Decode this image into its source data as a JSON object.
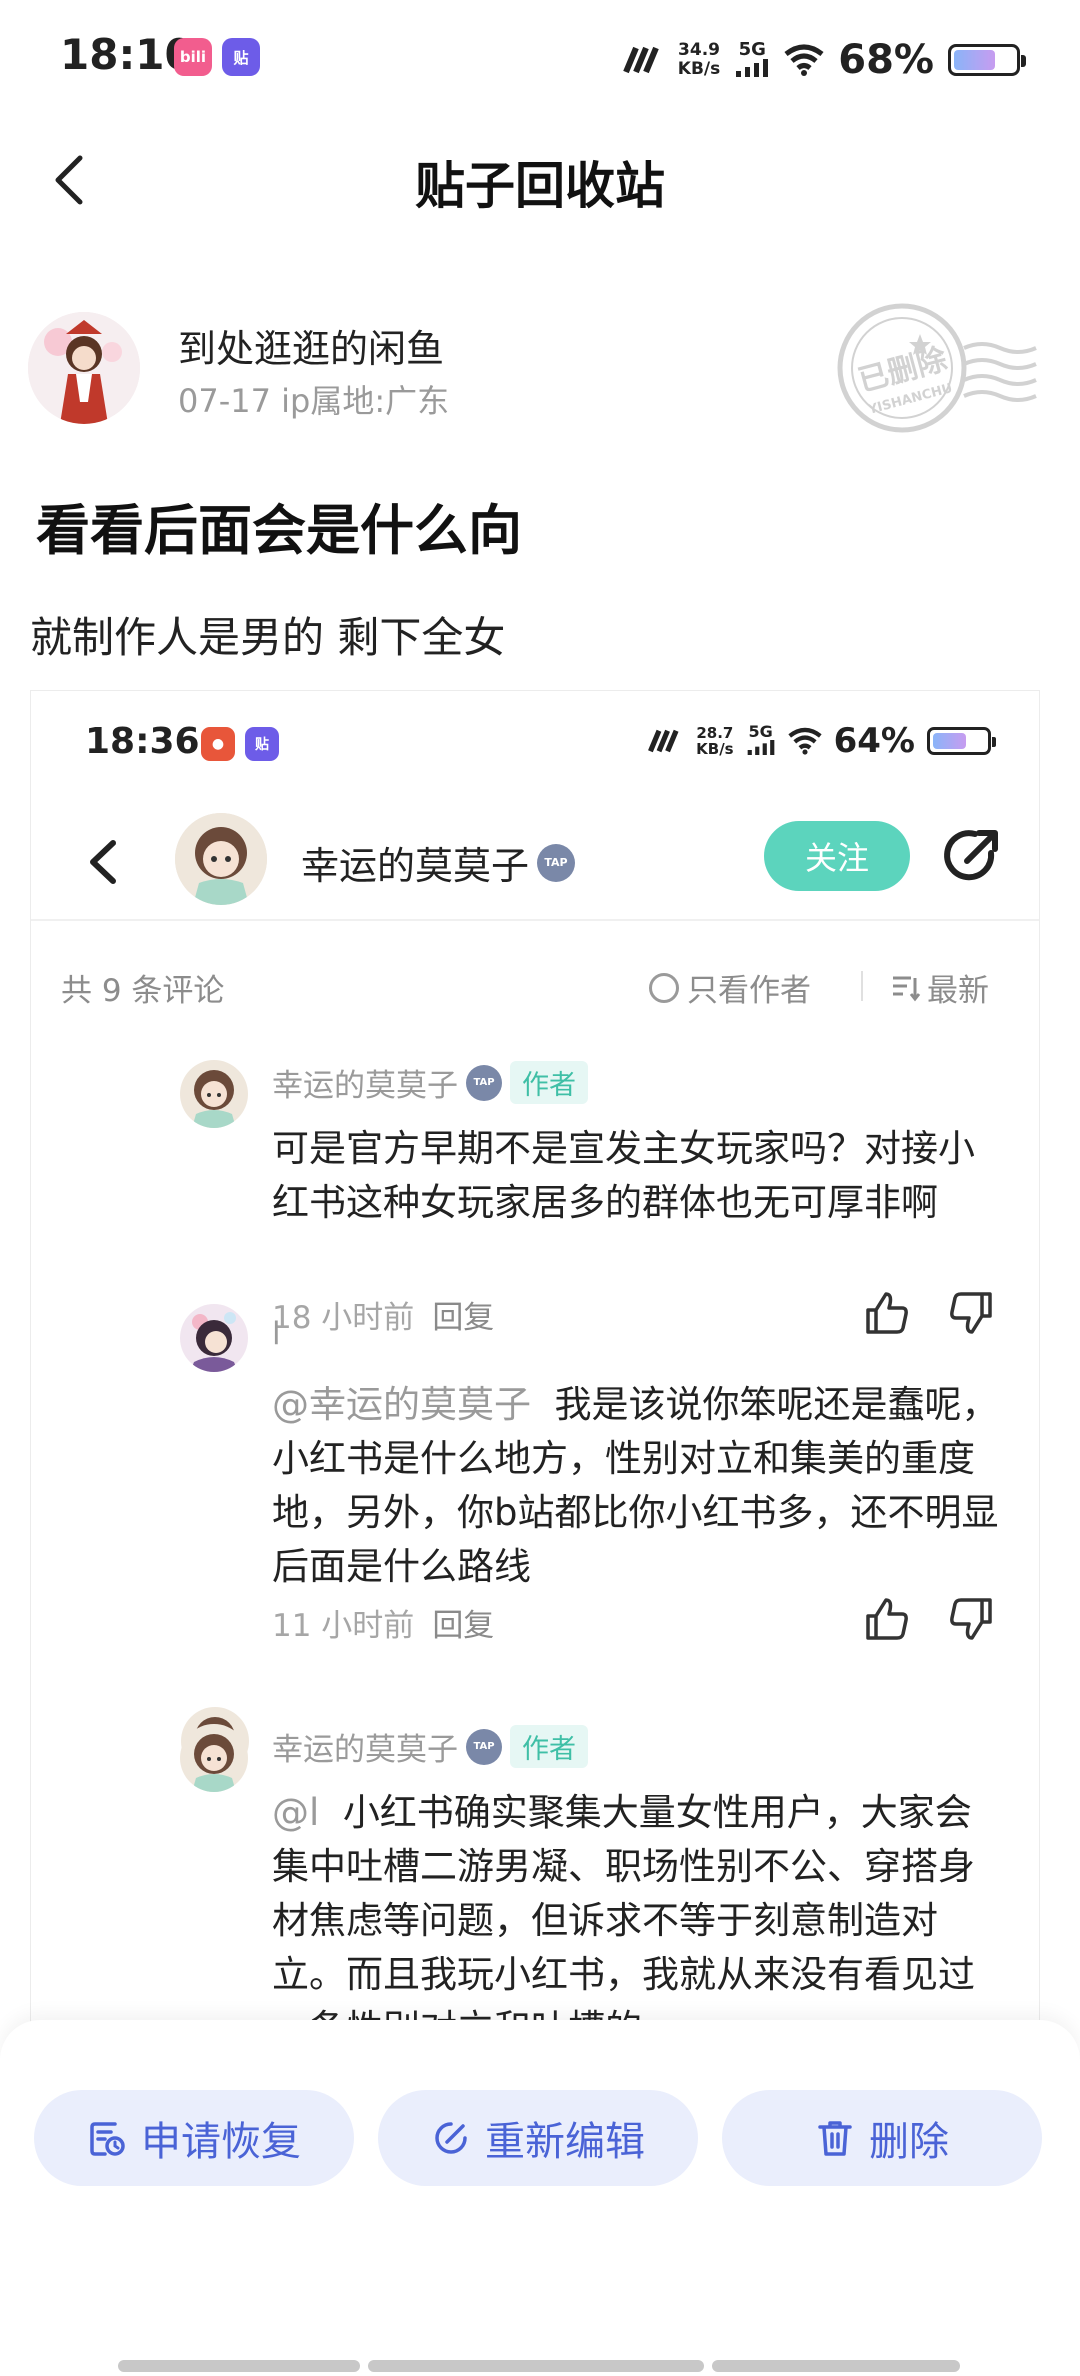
{
  "status_bar": {
    "time": "18:10",
    "app_icons": [
      "bilibili-icon",
      "tieba-icon"
    ],
    "speed_value": "34.9",
    "speed_unit": "KB/s",
    "network": "5G",
    "battery": "68%",
    "battery_level": 0.68
  },
  "header": {
    "back_icon": "chevron-left-icon",
    "title": "贴子回收站"
  },
  "author": {
    "name": "到处逛逛的闲鱼",
    "meta": "07-17  ip属地:广东",
    "stamp_text": "已删除",
    "stamp_subtext": "YISHANCHU"
  },
  "post": {
    "title": "看看后面会是什么向",
    "body": "就制作人是男的 剩下全女"
  },
  "screenshot": {
    "status_bar": {
      "time": "18:36",
      "speed_value": "28.7",
      "speed_unit": "KB/s",
      "network": "5G",
      "battery": "64%",
      "battery_level": 0.64
    },
    "header": {
      "username": "幸运的莫莫子",
      "badge": "TAP",
      "follow_label": "关注"
    },
    "filter": {
      "count_label": "共 9 条评论",
      "only_author_label": "只看作者",
      "sort_label": "最新"
    },
    "comments": [
      {
        "name": "幸运的莫莫子",
        "badge": "TAP",
        "tag": "作者",
        "mention": "",
        "text": "可是官方早期不是宣发主女玩家吗？对接小红书这种女玩家居多的群体也无可厚非啊",
        "time": "18 小时前",
        "reply": "回复"
      },
      {
        "name": "l",
        "badge": "",
        "tag": "",
        "mention": "@幸运的莫莫子",
        "text": "我是该说你笨呢还是蠢呢，小红书是什么地方，性别对立和集美的重度地，另外，你b站都比你小红书多，还不明显后面是什么路线",
        "time": "11 小时前",
        "reply": "回复"
      },
      {
        "name": "幸运的莫莫子",
        "badge": "TAP",
        "tag": "作者",
        "mention": "@l",
        "text": "小红书确实聚集大量女性用户，大家会集中吐槽二游男凝、职场性别不公、穿搭身材焦虑等问题，但诉求不等于刻意制造对立。而且我玩小红书，我就从来没有看见过一条性别对立和吐槽的",
        "time": "",
        "reply": ""
      }
    ]
  },
  "actions": {
    "restore_label": "申请恢复",
    "edit_label": "重新编辑",
    "delete_label": "删除"
  },
  "colors": {
    "accent_blue": "#4a63d6",
    "button_bg": "#eaeefc",
    "follow_green": "#5cd4bd",
    "author_tag": "#3fbfa6"
  }
}
